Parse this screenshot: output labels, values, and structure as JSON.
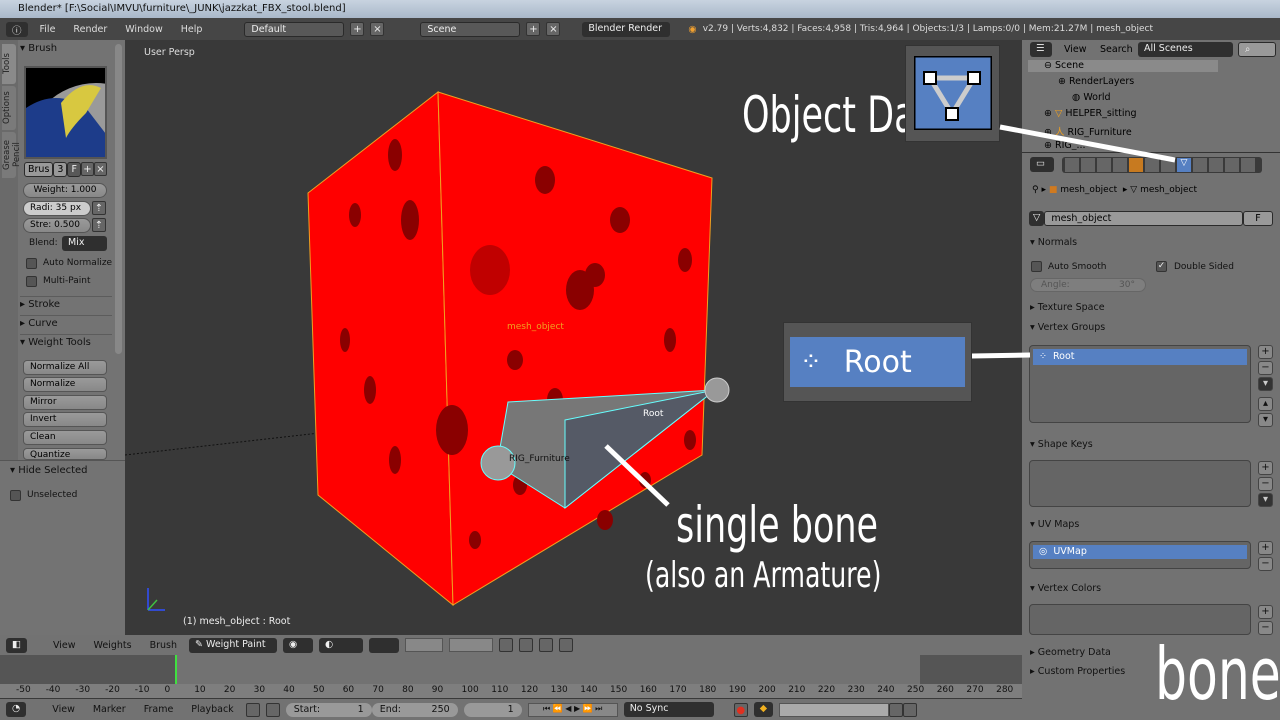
{
  "window": {
    "title": "Blender* [F:\\Social\\IMVU\\furniture\\_JUNK\\jazzkat_FBX_stool.blend]"
  },
  "menubar": {
    "items": [
      "File",
      "Render",
      "Window",
      "Help"
    ],
    "layout": "Default",
    "scene": "Scene",
    "engine": "Blender Render",
    "stats": "v2.79 | Verts:4,832 | Faces:4,958 | Tris:4,964 | Objects:1/3 | Lamps:0/0 | Mem:21.27M | mesh_object"
  },
  "tools": {
    "tabs": [
      "Tools",
      "Options",
      "Grease Pencil"
    ],
    "brush_header": "Brush",
    "brush_name": "Brus",
    "brush_users": "3",
    "brush_fake": "F",
    "weight": "Weight:  1.000",
    "radius": "Radi: 35 px",
    "strength": "Stre: 0.500",
    "blend_label": "Blend:",
    "blend_value": "Mix",
    "auto_normalize": "Auto Normalize",
    "multi_paint": "Multi-Paint",
    "stroke": "Stroke",
    "curve": "Curve",
    "weight_tools": "Weight Tools",
    "buttons": [
      "Normalize All",
      "Normalize",
      "Mirror",
      "Invert",
      "Clean",
      "Quantize"
    ],
    "hide_selected": "Hide Selected",
    "unselected": "Unselected"
  },
  "viewport": {
    "view_label": "User Persp",
    "object_label": "mesh_object",
    "bone_label": "Root",
    "armature_label": "RIG_Furniture",
    "status": "(1) mesh_object : Root",
    "colors": {
      "mesh": "#ff0000",
      "spots": "#8a0000"
    }
  },
  "outliner": {
    "view": "View",
    "search": "Search",
    "filter": "All Scenes",
    "items": [
      "Scene",
      "RenderLayers",
      "World",
      "HELPER_sitting",
      "RIG_Furniture",
      "RIG_..."
    ]
  },
  "properties": {
    "breadcrumb": [
      "mesh_object",
      "mesh_object"
    ],
    "datablock": "mesh_object",
    "fake": "F",
    "normals": "Normals",
    "auto_smooth": "Auto Smooth",
    "double_sided": "Double Sided",
    "double_sided_checked": true,
    "angle_label": "Angle:",
    "angle_value": "30°",
    "texture_space": "Texture Space",
    "vertex_groups": "Vertex Groups",
    "vertex_group_items": [
      "Root"
    ],
    "shape_keys": "Shape Keys",
    "uv_maps": "UV Maps",
    "uv_items": [
      "UVMap"
    ],
    "vertex_colors": "Vertex Colors",
    "geometry_data": "Geometry Data",
    "custom_properties": "Custom Properties",
    "active_tab": "object-data",
    "accent": "#5680c2"
  },
  "vphead": {
    "items": [
      "View",
      "Weights",
      "Brush"
    ],
    "mode": "Weight Paint"
  },
  "timeline": {
    "ticks": [
      "-50",
      "-40",
      "-30",
      "-20",
      "-10",
      "0",
      "10",
      "20",
      "30",
      "40",
      "50",
      "60",
      "70",
      "80",
      "90",
      "100",
      "110",
      "120",
      "130",
      "140",
      "150",
      "160",
      "170",
      "180",
      "190",
      "200",
      "210",
      "220",
      "230",
      "240",
      "250",
      "260",
      "270",
      "280"
    ],
    "current_frame": 0,
    "menu": [
      "View",
      "Marker",
      "Frame",
      "Playback"
    ],
    "start": "Start:",
    "start_value": "1",
    "end": "End:",
    "end_value": "250",
    "frame": "1",
    "sync": "No Sync"
  },
  "annotations": {
    "object_data": "Object Data",
    "root_callout": "Root",
    "single_bone": "single bone",
    "also_armature": "(also an Armature)",
    "bones": "bones"
  }
}
